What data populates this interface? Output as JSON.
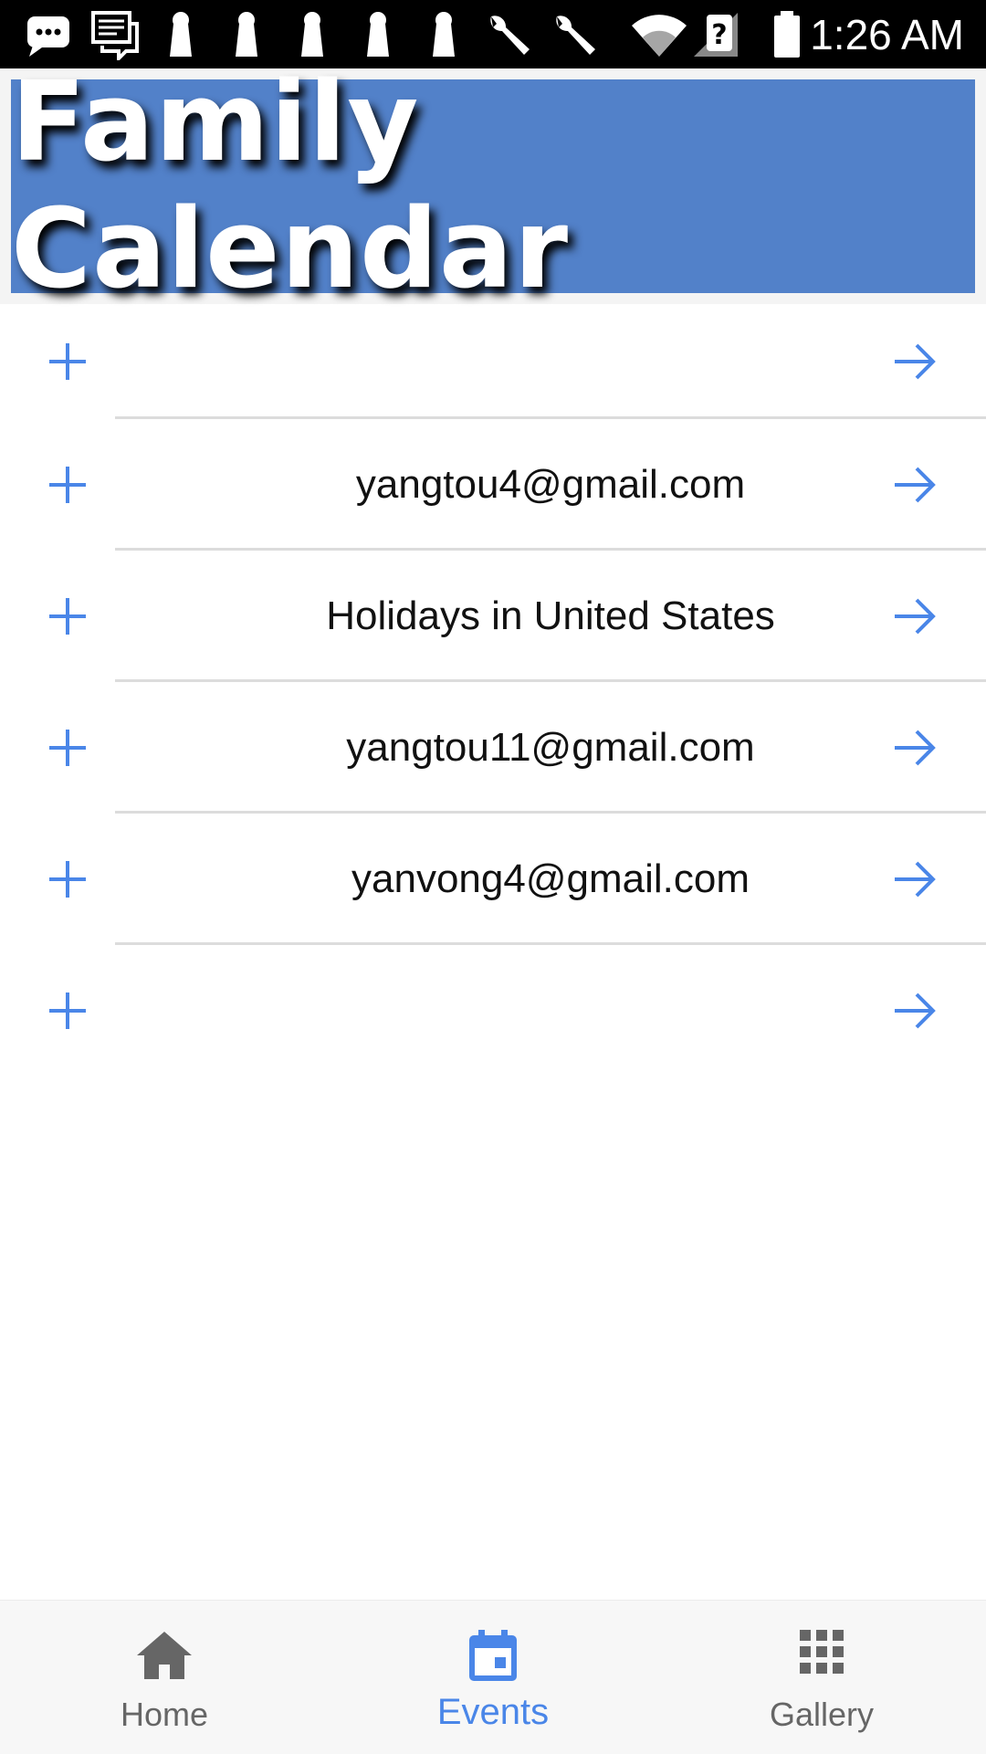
{
  "status_bar": {
    "time": "1:26 AM",
    "icons": [
      "chat-bubble-icon",
      "message-icon",
      "keyhole-icon",
      "keyhole-icon",
      "keyhole-icon",
      "keyhole-icon",
      "keyhole-icon",
      "wrench-icon",
      "wrench-icon",
      "wifi-icon",
      "no-signal-icon",
      "battery-icon"
    ]
  },
  "header": {
    "title": "Family Calendar",
    "color": "#5281c9"
  },
  "calendar_list": {
    "accent_color": "#4a86e8",
    "items": [
      {
        "label": ""
      },
      {
        "label": "yangtou4@gmail.com"
      },
      {
        "label": "Holidays in United States"
      },
      {
        "label": "yangtou11@gmail.com"
      },
      {
        "label": "yanvong4@gmail.com"
      },
      {
        "label": ""
      }
    ]
  },
  "bottom_nav": {
    "items": [
      {
        "label": "Home",
        "icon": "home-icon",
        "active": false
      },
      {
        "label": "Events",
        "icon": "calendar-icon",
        "active": true
      },
      {
        "label": "Gallery",
        "icon": "grid-icon",
        "active": false
      }
    ]
  }
}
